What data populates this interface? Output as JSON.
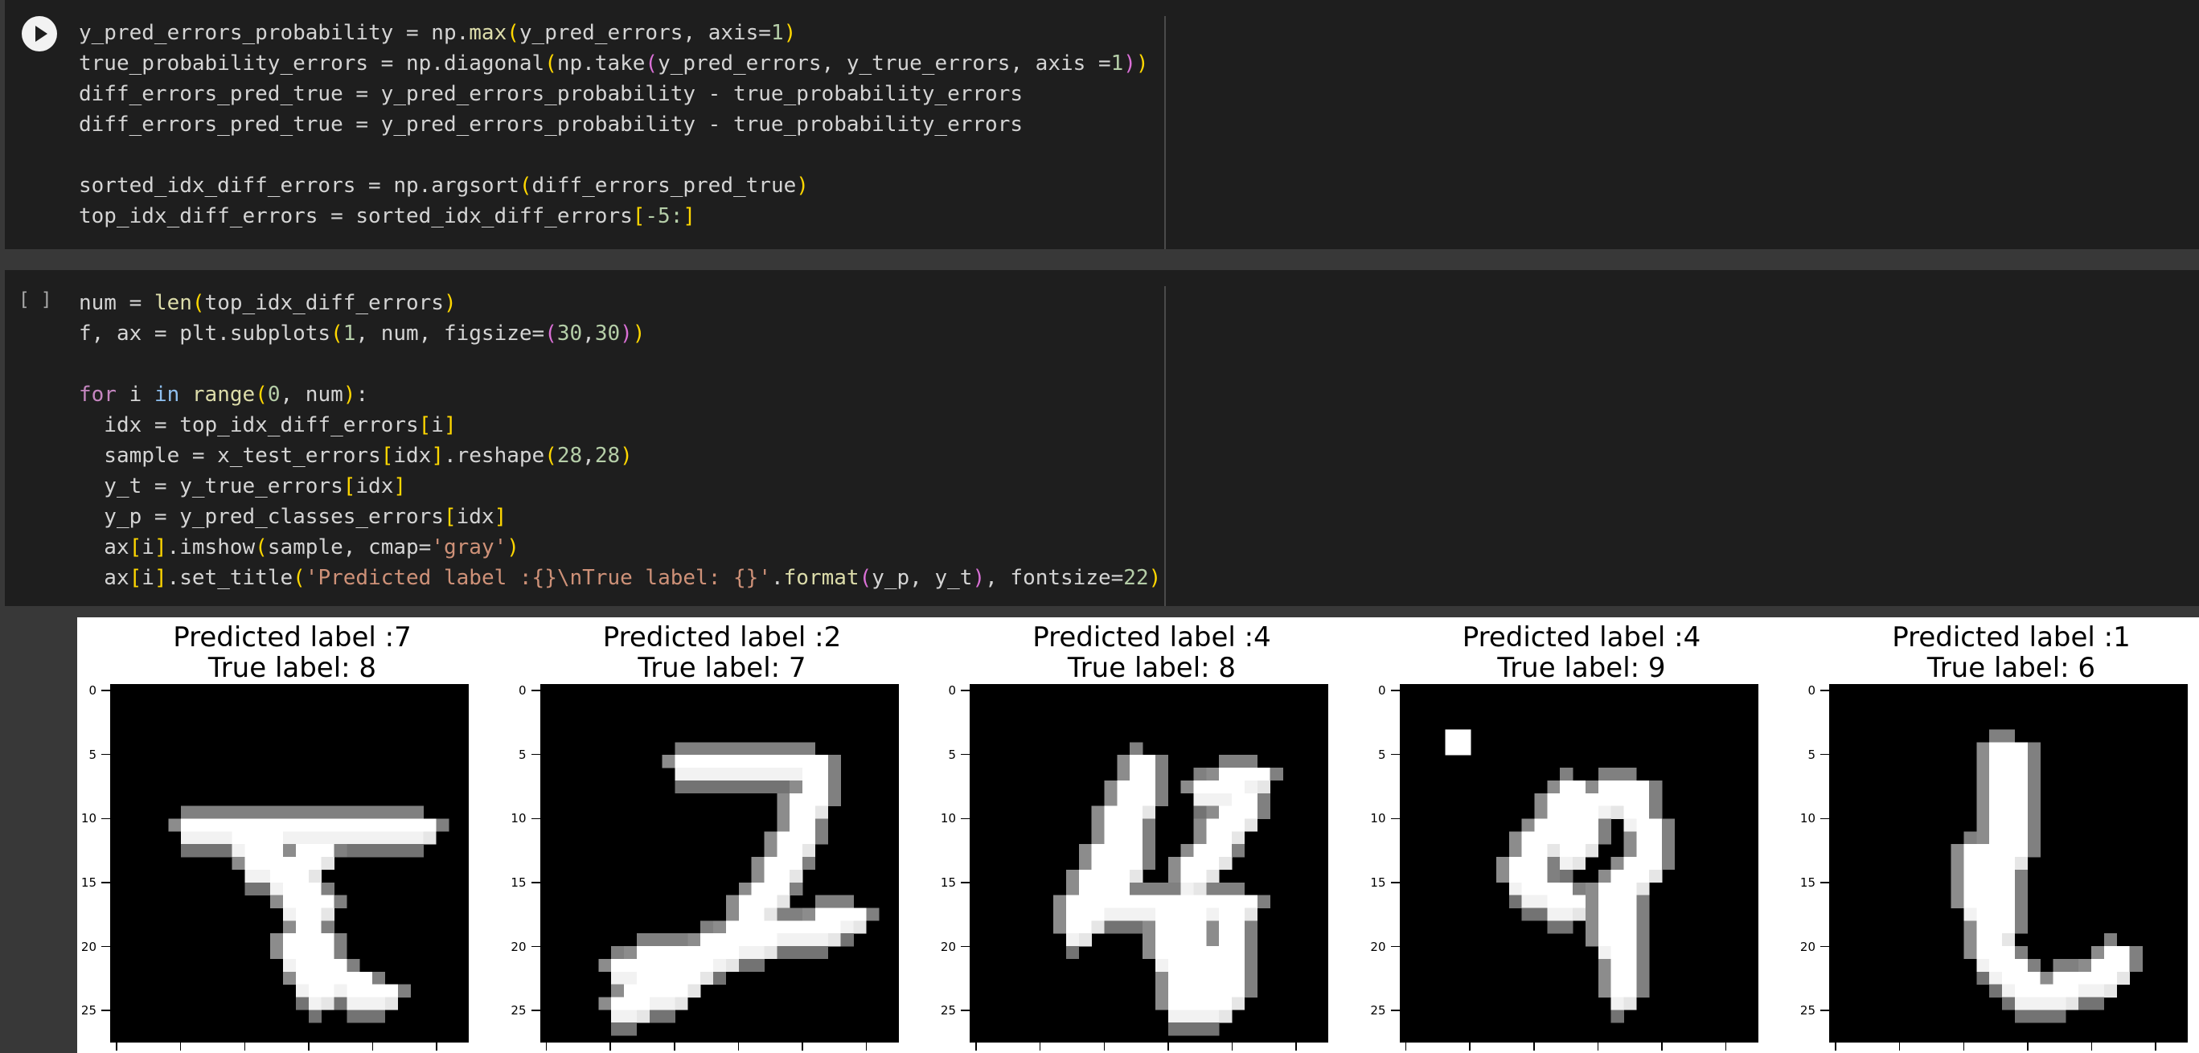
{
  "cells": [
    {
      "id": "cell1",
      "run_button": "play-icon",
      "lines": [
        [
          [
            "y_pred_errors_probability = np.",
            ""
          ],
          [
            "max",
            "fn"
          ],
          [
            "(",
            "br"
          ],
          [
            "y_pred_errors, axis=",
            ""
          ],
          [
            "1",
            "num"
          ],
          [
            ")",
            "br"
          ]
        ],
        [
          [
            "true_probability_errors = np.diagonal",
            ""
          ],
          [
            "(",
            "br"
          ],
          [
            "np.take",
            ""
          ],
          [
            "(",
            "br2"
          ],
          [
            "y_pred_errors, y_true_errors, axis =",
            ""
          ],
          [
            "1",
            "num"
          ],
          [
            ")",
            "br2"
          ],
          [
            ")",
            "br"
          ]
        ],
        [
          [
            "diff_errors_pred_true = y_pred_errors_probability - true_probability_errors",
            ""
          ]
        ],
        [
          [
            "diff_errors_pred_true = y_pred_errors_probability - true_probability_errors",
            ""
          ]
        ],
        [
          [
            "",
            ""
          ]
        ],
        [
          [
            "sorted_idx_diff_errors = np.argsort",
            ""
          ],
          [
            "(",
            "br"
          ],
          [
            "diff_errors_pred_true",
            ""
          ],
          [
            ")",
            "br"
          ]
        ],
        [
          [
            "top_idx_diff_errors = sorted_idx_diff_errors",
            ""
          ],
          [
            "[",
            "br"
          ],
          [
            "-5:",
            "num"
          ],
          [
            "]",
            "br"
          ]
        ]
      ]
    },
    {
      "id": "cell2",
      "exec_count": "[ ]",
      "lines": [
        [
          [
            "num = ",
            ""
          ],
          [
            "len",
            "fn"
          ],
          [
            "(",
            "br"
          ],
          [
            "top_idx_diff_errors",
            ""
          ],
          [
            ")",
            "br"
          ]
        ],
        [
          [
            "f, ax = plt.subplots",
            ""
          ],
          [
            "(",
            "br"
          ],
          [
            "1",
            "num"
          ],
          [
            ", num, figsize=",
            ""
          ],
          [
            "(",
            "br2"
          ],
          [
            "30",
            "num"
          ],
          [
            ",",
            ""
          ],
          [
            "30",
            "num"
          ],
          [
            ")",
            "br2"
          ],
          [
            ")",
            "br"
          ]
        ],
        [
          [
            "",
            ""
          ]
        ],
        [
          [
            "for",
            "kw"
          ],
          [
            " i ",
            ""
          ],
          [
            "in",
            "bi"
          ],
          [
            " ",
            ""
          ],
          [
            "range",
            "fn"
          ],
          [
            "(",
            "br"
          ],
          [
            "0",
            "num"
          ],
          [
            ", num",
            ""
          ],
          [
            ")",
            "br"
          ],
          [
            ":",
            ""
          ]
        ],
        [
          [
            "  idx = top_idx_diff_errors",
            ""
          ],
          [
            "[",
            "br"
          ],
          [
            "i",
            ""
          ],
          [
            "]",
            "br"
          ]
        ],
        [
          [
            "  sample = x_test_errors",
            ""
          ],
          [
            "[",
            "br"
          ],
          [
            "idx",
            ""
          ],
          [
            "]",
            "br"
          ],
          [
            ".reshape",
            ""
          ],
          [
            "(",
            "br"
          ],
          [
            "28",
            "num"
          ],
          [
            ",",
            ""
          ],
          [
            "28",
            "num"
          ],
          [
            ")",
            "br"
          ]
        ],
        [
          [
            "  y_t = y_true_errors",
            ""
          ],
          [
            "[",
            "br"
          ],
          [
            "idx",
            ""
          ],
          [
            "]",
            "br"
          ]
        ],
        [
          [
            "  y_p = y_pred_classes_errors",
            ""
          ],
          [
            "[",
            "br"
          ],
          [
            "idx",
            ""
          ],
          [
            "]",
            "br"
          ]
        ],
        [
          [
            "  ax",
            ""
          ],
          [
            "[",
            "br"
          ],
          [
            "i",
            ""
          ],
          [
            "]",
            "br"
          ],
          [
            ".imshow",
            ""
          ],
          [
            "(",
            "br"
          ],
          [
            "sample, cmap=",
            ""
          ],
          [
            "'gray'",
            "str"
          ],
          [
            ")",
            "br"
          ]
        ],
        [
          [
            "  ax",
            ""
          ],
          [
            "[",
            "br"
          ],
          [
            "i",
            ""
          ],
          [
            "]",
            "br"
          ],
          [
            ".set_title",
            ""
          ],
          [
            "(",
            "br"
          ],
          [
            "'Predicted label :{}\\nTrue label: {}'",
            "str"
          ],
          [
            ".",
            ""
          ],
          [
            "format",
            "fn"
          ],
          [
            "(",
            "br2"
          ],
          [
            "y_p, y_t",
            ""
          ],
          [
            ")",
            "br2"
          ],
          [
            ", fontsize=",
            ""
          ],
          [
            "22",
            "num"
          ],
          [
            ")",
            "br"
          ]
        ]
      ]
    }
  ],
  "output": {
    "yticks": [
      "0",
      "5",
      "10",
      "15",
      "20",
      "25"
    ],
    "subplots": [
      {
        "pred_title": "Predicted label :7",
        "true_title": "True label: 8"
      },
      {
        "pred_title": "Predicted label :2",
        "true_title": "True label: 7"
      },
      {
        "pred_title": "Predicted label :4",
        "true_title": "True label: 8"
      },
      {
        "pred_title": "Predicted label :4",
        "true_title": "True label: 9"
      },
      {
        "pred_title": "Predicted label :1",
        "true_title": "True label: 6"
      }
    ]
  }
}
